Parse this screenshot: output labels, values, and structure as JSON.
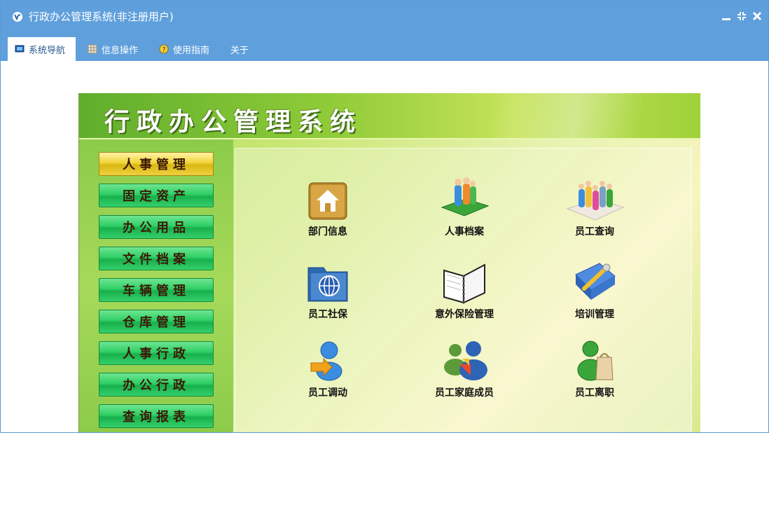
{
  "window": {
    "title": "行政办公管理系统(非注册用户)"
  },
  "menu": [
    {
      "label": "系统导航",
      "icon": "monitor-icon"
    },
    {
      "label": "信息操作",
      "icon": "grid-icon"
    },
    {
      "label": "使用指南",
      "icon": "help-icon"
    },
    {
      "label": "关于",
      "icon": ""
    }
  ],
  "banner": {
    "title": "行政办公管理系统"
  },
  "sidebar": [
    {
      "label": "人事管理"
    },
    {
      "label": "固定资产"
    },
    {
      "label": "办公用品"
    },
    {
      "label": "文件档案"
    },
    {
      "label": "车辆管理"
    },
    {
      "label": "仓库管理"
    },
    {
      "label": "人事行政"
    },
    {
      "label": "办公行政"
    },
    {
      "label": "查询报表"
    }
  ],
  "tiles": [
    {
      "label": "部门信息",
      "icon": "house-icon"
    },
    {
      "label": "人事档案",
      "icon": "people-book-icon"
    },
    {
      "label": "员工查询",
      "icon": "people-group-icon"
    },
    {
      "label": "员工社保",
      "icon": "globe-folder-icon"
    },
    {
      "label": "意外保险管理",
      "icon": "open-book-icon"
    },
    {
      "label": "培训管理",
      "icon": "tools-book-icon"
    },
    {
      "label": "员工调动",
      "icon": "user-arrow-icon"
    },
    {
      "label": "员工家庭成员",
      "icon": "users-icon"
    },
    {
      "label": "员工离职",
      "icon": "user-bag-icon"
    }
  ],
  "colors": {
    "titlebar": "#5fa0dc",
    "sidebar_button": "#2fcf65",
    "sidebar_button_active": "#f2d43a"
  }
}
